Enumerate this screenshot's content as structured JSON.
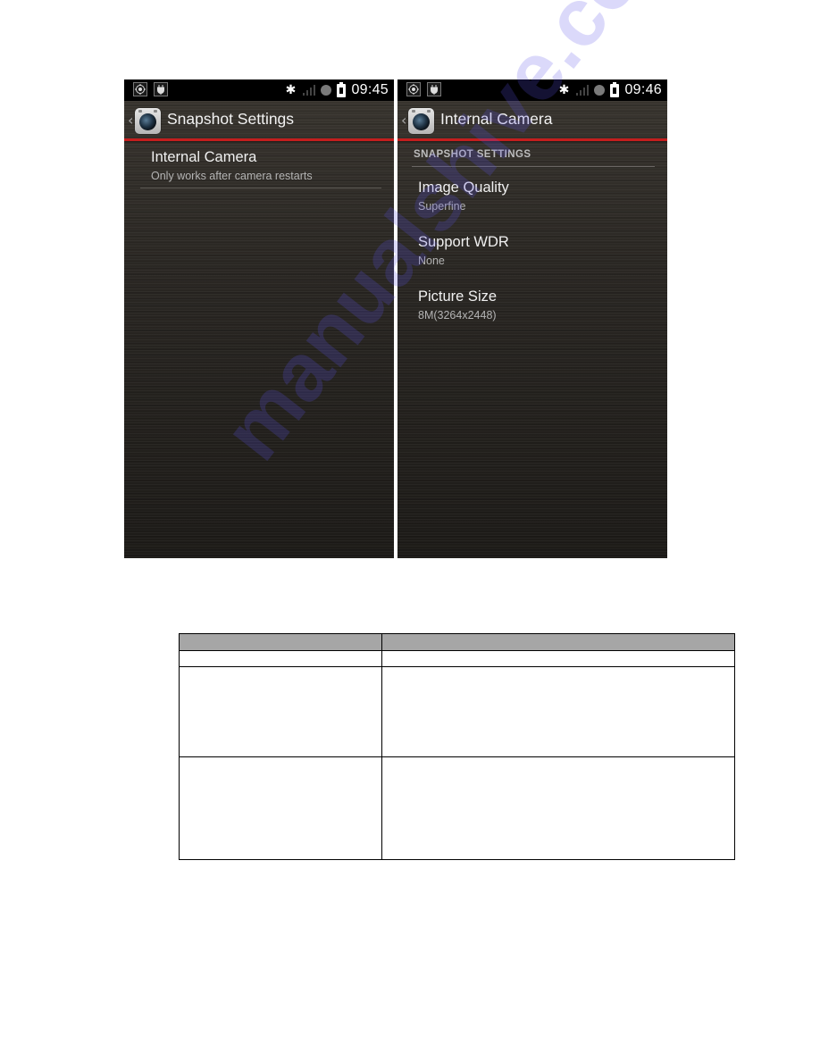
{
  "screens": [
    {
      "status": {
        "clock": "09:45",
        "icons": [
          "location-icon",
          "usb-plug-icon",
          "bluetooth-icon",
          "signal-icon",
          "sync-dot-icon",
          "battery-charging-icon"
        ]
      },
      "actionbar": {
        "title": "Snapshot Settings",
        "icon": "camera-app-icon"
      },
      "items": [
        {
          "title": "Internal Camera",
          "summary": "Only works after camera restarts"
        }
      ]
    },
    {
      "status": {
        "clock": "09:46",
        "icons": [
          "location-icon",
          "usb-plug-icon",
          "bluetooth-icon",
          "signal-icon",
          "sync-dot-icon",
          "battery-charging-icon"
        ]
      },
      "actionbar": {
        "title": "Internal Camera",
        "icon": "camera-app-icon"
      },
      "category": "SNAPSHOT SETTINGS",
      "items": [
        {
          "title": "Image Quality",
          "summary": "Superfine"
        },
        {
          "title": "Support WDR",
          "summary": "None"
        },
        {
          "title": "Picture Size",
          "summary": "8M(3264x2448)"
        }
      ]
    }
  ],
  "table": {
    "headers": [
      "",
      ""
    ],
    "rows": [
      [
        "",
        ""
      ],
      [
        "",
        ""
      ],
      [
        "",
        ""
      ]
    ]
  },
  "watermark": "manualshive.com",
  "colors": {
    "accent_red": "#c41e1e",
    "table_header": "#a6a6a6"
  }
}
